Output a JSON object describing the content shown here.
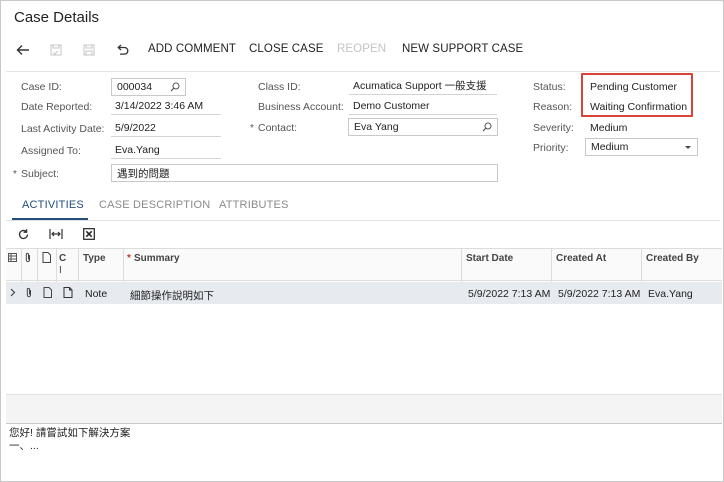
{
  "page": {
    "title": "Case Details"
  },
  "toolbar": {
    "add_comment": "ADD COMMENT",
    "close_case": "CLOSE CASE",
    "reopen": "REOPEN",
    "new_support_case": "NEW SUPPORT CASE"
  },
  "form": {
    "case_id": {
      "label": "Case ID:",
      "value": "000034"
    },
    "date_reported": {
      "label": "Date Reported:",
      "value": "3/14/2022 3:46 AM"
    },
    "last_activity": {
      "label": "Last Activity Date:",
      "value": "5/9/2022"
    },
    "assigned_to": {
      "label": "Assigned To:",
      "value": "Eva.Yang"
    },
    "subject": {
      "label": "Subject:",
      "value": "遇到的問題"
    },
    "class_id": {
      "label": "Class ID:",
      "value": "Acumatica Support 一般支援"
    },
    "business_account": {
      "label": "Business Account:",
      "value": "Demo Customer"
    },
    "contact": {
      "label": "Contact:",
      "value": "Eva Yang"
    },
    "status": {
      "label": "Status:",
      "value": "Pending Customer"
    },
    "reason": {
      "label": "Reason:",
      "value": "Waiting Confirmation"
    },
    "severity": {
      "label": "Severity:",
      "value": "Medium"
    },
    "priority": {
      "label": "Priority:",
      "value": "Medium"
    },
    "required_mark": "*"
  },
  "tabs": [
    {
      "label": "ACTIVITIES",
      "active": true
    },
    {
      "label": "CASE DESCRIPTION",
      "active": false
    },
    {
      "label": "ATTRIBUTES",
      "active": false
    }
  ],
  "grid": {
    "columns": {
      "c_short": "C",
      "c_short2": "I",
      "type": "Type",
      "summary_req": "*",
      "summary": "Summary",
      "start_date": "Start Date",
      "created_at": "Created At",
      "created_by": "Created By"
    },
    "rows": [
      {
        "type": "Note",
        "summary": "細節操作說明如下",
        "start_date": "5/9/2022 7:13 AM",
        "created_at": "5/9/2022 7:13 AM",
        "created_by": "Eva.Yang"
      }
    ]
  },
  "preview": {
    "line1": "您好! 請嘗試如下解決方案",
    "line2": "一、..."
  },
  "colors": {
    "highlight_border": "#d9443a",
    "active_tab": "#234e7d",
    "selected_row": "#e7eaef"
  }
}
